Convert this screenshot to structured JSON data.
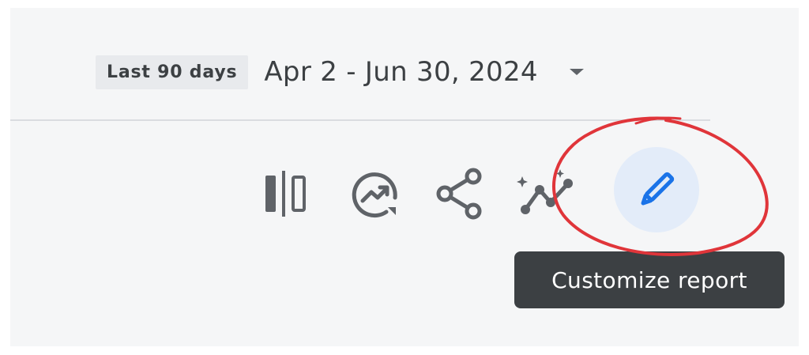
{
  "date_picker": {
    "range_label": "Last 90 days",
    "date_range": "Apr 2 - Jun 30, 2024",
    "dropdown_icon": "arrow-drop-down-icon"
  },
  "toolbar": {
    "buttons": [
      {
        "icon": "compare-icon"
      },
      {
        "icon": "insights-icon"
      },
      {
        "icon": "share-icon"
      },
      {
        "icon": "sparkle-trend-icon"
      },
      {
        "icon": "pencil-edit-icon"
      }
    ],
    "edit_tooltip": "Customize report"
  },
  "colors": {
    "icon_gray": "#5f6368",
    "edit_accent": "#1a73e8",
    "edit_bg": "#e3ecf9",
    "tooltip_bg": "#3c4043",
    "annotation_red": "#e0353a"
  }
}
